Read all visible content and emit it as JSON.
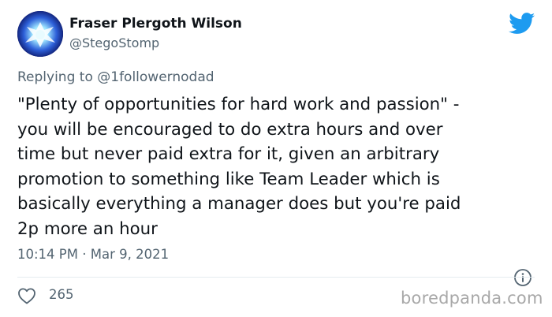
{
  "author": {
    "display_name": "Fraser Plergoth Wilson",
    "handle": "@StegoStomp",
    "avatar_icon": "glowing-creature-avatar"
  },
  "reply": {
    "prefix": "Replying to ",
    "mention": "@1followernodad"
  },
  "tweet": {
    "text": "\"Plenty of opportunities for hard work and passion\" -\nyou will be encouraged to do extra hours and over\ntime but never paid extra for it, given an arbitrary\npromotion to something like Team Leader which is\nbasically everything a manager does but you're paid\n2p more an hour",
    "timestamp": "10:14 PM · Mar 9, 2021",
    "likes": "265"
  },
  "icons": {
    "brand": "twitter-bird-icon",
    "info": "info-icon",
    "like": "heart-icon"
  },
  "watermark": "boredpanda.com",
  "colors": {
    "twitter_blue": "#1d9bf0",
    "secondary_text": "#536471",
    "primary_text": "#0f1419",
    "watermark": "#a8a8a8"
  }
}
